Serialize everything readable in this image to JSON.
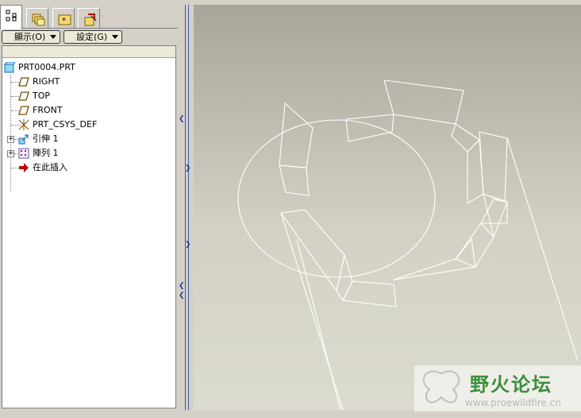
{
  "tabs": [
    {
      "name": "model-tree",
      "active": true
    },
    {
      "name": "folder-browser",
      "active": false
    },
    {
      "name": "favorites",
      "active": false
    },
    {
      "name": "connections",
      "active": false
    }
  ],
  "toolbar": {
    "display_label": "顯示(O)",
    "settings_label": "設定(G)"
  },
  "tree": {
    "root": "PRT0004.PRT",
    "items": [
      {
        "label": "RIGHT",
        "icon": "datum-plane-icon"
      },
      {
        "label": "TOP",
        "icon": "datum-plane-icon"
      },
      {
        "label": "FRONT",
        "icon": "datum-plane-icon"
      },
      {
        "label": "PRT_CSYS_DEF",
        "icon": "coordinate-system-icon"
      },
      {
        "label": "引伸 1",
        "icon": "extrude-icon",
        "expandable": true
      },
      {
        "label": "陣列 1",
        "icon": "pattern-icon",
        "expandable": true
      },
      {
        "label": "在此插入",
        "icon": "insert-here-arrow-icon"
      }
    ]
  },
  "watermark": {
    "title": "野火论坛",
    "url": "www.proewildfire.cn"
  },
  "colors": {
    "tree_icon_blue": "#1a6fb8",
    "insert_red": "#c00000",
    "splitter_blue": "#3a5ea8",
    "watermark_green": "#3c8f3c"
  }
}
